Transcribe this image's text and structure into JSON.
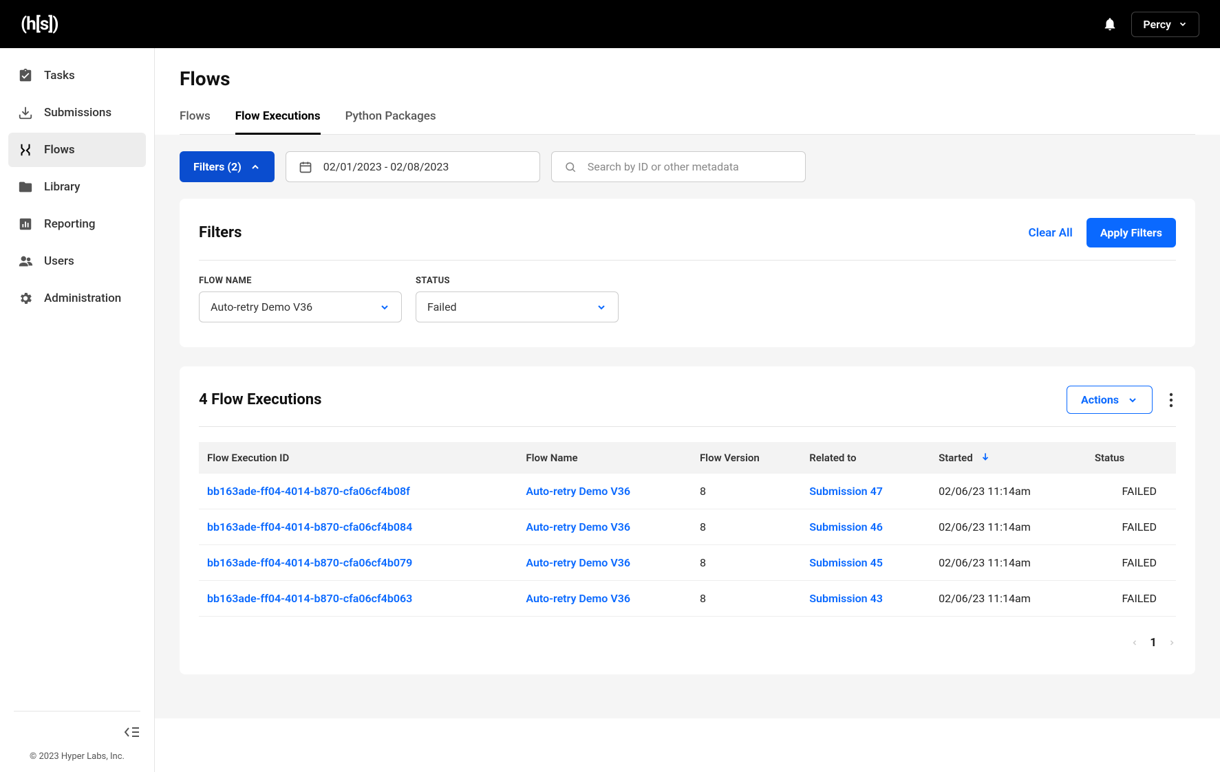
{
  "header": {
    "logo": "(h[s])",
    "user": "Percy"
  },
  "sidebar": {
    "items": [
      {
        "label": "Tasks"
      },
      {
        "label": "Submissions"
      },
      {
        "label": "Flows"
      },
      {
        "label": "Library"
      },
      {
        "label": "Reporting"
      },
      {
        "label": "Users"
      },
      {
        "label": "Administration"
      }
    ],
    "copyright": "© 2023 Hyper Labs, Inc."
  },
  "page": {
    "title": "Flows",
    "tabs": [
      {
        "label": "Flows"
      },
      {
        "label": "Flow Executions"
      },
      {
        "label": "Python Packages"
      }
    ]
  },
  "toolbar": {
    "filters_label": "Filters (2)",
    "date_range": "02/01/2023 - 02/08/2023",
    "search_placeholder": "Search by ID or other metadata"
  },
  "filters_panel": {
    "title": "Filters",
    "clear_label": "Clear All",
    "apply_label": "Apply Filters",
    "fields": {
      "flow_name": {
        "label": "FLOW NAME",
        "value": "Auto-retry Demo V36"
      },
      "status": {
        "label": "STATUS",
        "value": "Failed"
      }
    }
  },
  "results": {
    "title": "4 Flow Executions",
    "actions_label": "Actions",
    "columns": [
      "Flow Execution ID",
      "Flow Name",
      "Flow Version",
      "Related to",
      "Started",
      "Status"
    ],
    "rows": [
      {
        "id": "bb163ade-ff04-4014-b870-cfa06cf4b08f",
        "flow": "Auto-retry Demo V36",
        "version": "8",
        "related": "Submission 47",
        "started": "02/06/23 11:14am",
        "status": "FAILED"
      },
      {
        "id": "bb163ade-ff04-4014-b870-cfa06cf4b084",
        "flow": "Auto-retry Demo V36",
        "version": "8",
        "related": "Submission 46",
        "started": "02/06/23 11:14am",
        "status": "FAILED"
      },
      {
        "id": "bb163ade-ff04-4014-b870-cfa06cf4b079",
        "flow": "Auto-retry Demo V36",
        "version": "8",
        "related": "Submission 45",
        "started": "02/06/23 11:14am",
        "status": "FAILED"
      },
      {
        "id": "bb163ade-ff04-4014-b870-cfa06cf4b063",
        "flow": "Auto-retry Demo V36",
        "version": "8",
        "related": "Submission 43",
        "started": "02/06/23 11:14am",
        "status": "FAILED"
      }
    ],
    "page": "1"
  }
}
